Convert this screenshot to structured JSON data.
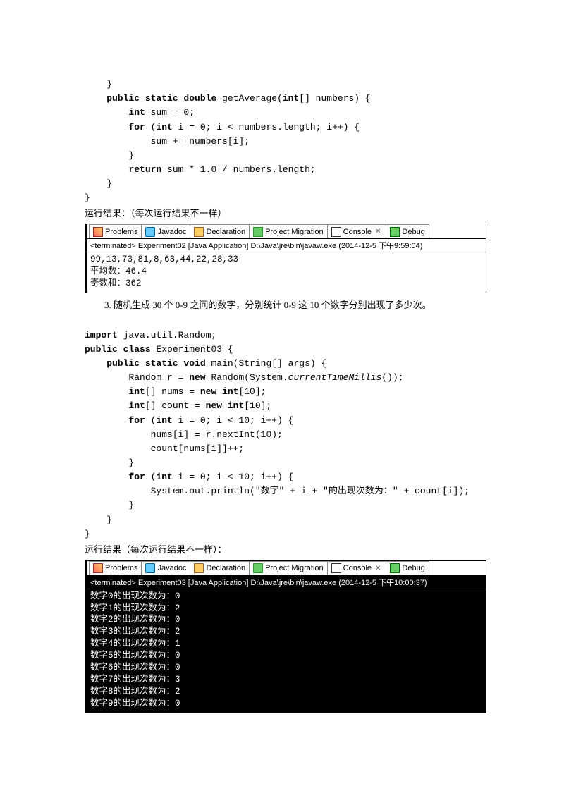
{
  "code1": {
    "l1": "    }",
    "l2a": "    ",
    "l2b": "public static double",
    "l2c": " getAverage(",
    "l2d": "int",
    "l2e": "[] numbers) {",
    "l3a": "        ",
    "l3b": "int",
    "l3c": " sum = 0;",
    "l4a": "        ",
    "l4b": "for",
    "l4c": " (",
    "l4d": "int",
    "l4e": " i = 0; i < numbers.length; i++) {",
    "l5": "            sum += numbers[i];",
    "l6": "        }",
    "l7a": "        ",
    "l7b": "return",
    "l7c": " sum * 1.0 / numbers.length;",
    "l8": "    }",
    "l9": "}"
  },
  "text1": "运行结果：（每次运行结果不一样）",
  "tabs": {
    "problems": "Problems",
    "javadoc": "Javadoc",
    "declaration": "Declaration",
    "project": "Project Migration",
    "console": "Console",
    "debug": "Debug",
    "close": "✕"
  },
  "console1": {
    "term": "<terminated> Experiment02 [Java Application] D:\\Java\\jre\\bin\\javaw.exe (2014-12-5 下午9:59:04)",
    "out": "99,13,73,81,8,63,44,22,28,33\n平均数：46.4\n奇数和：362"
  },
  "text2": "3. 随机生成 30 个 0-9 之间的数字，分别统计 0-9 这 10 个数字分别出现了多少次。",
  "code2": {
    "l1a": "import",
    "l1b": " java.util.Random;",
    "l2a": "public class",
    "l2b": " Experiment03 {",
    "l3a": "    ",
    "l3b": "public static void",
    "l3c": " main(String[] args) {",
    "l4a": "        Random r = ",
    "l4b": "new",
    "l4c": " Random(System.",
    "l4d": "currentTimeMillis",
    "l4e": "());",
    "l5a": "        ",
    "l5b": "int",
    "l5c": "[] nums = ",
    "l5d": "new int",
    "l5e": "[10];",
    "l6a": "        ",
    "l6b": "int",
    "l6c": "[] count = ",
    "l6d": "new int",
    "l6e": "[10];",
    "l7a": "        ",
    "l7b": "for",
    "l7c": " (",
    "l7d": "int",
    "l7e": " i = 0; i < 10; i++) {",
    "l8": "            nums[i] = r.nextInt(10);",
    "l9": "            count[nums[i]]++;",
    "l10": "        }",
    "l11a": "        ",
    "l11b": "for",
    "l11c": " (",
    "l11d": "int",
    "l11e": " i = 0; i < 10; i++) {",
    "l12": "            System.out.println(\"数字\" + i + \"的出现次数为：\" + count[i]);",
    "l13": "        }",
    "l14": "    }",
    "l15": "}"
  },
  "text3": "运行结果（每次运行结果不一样）：",
  "console2": {
    "term": "<terminated> Experiment03 [Java Application] D:\\Java\\jre\\bin\\javaw.exe (2014-12-5 下午10:00:37)",
    "out": "数字0的出现次数为：0\n数字1的出现次数为：2\n数字2的出现次数为：0\n数字3的出现次数为：2\n数字4的出现次数为：1\n数字5的出现次数为：0\n数字6的出现次数为：0\n数字7的出现次数为：3\n数字8的出现次数为：2\n数字9的出现次数为：0"
  }
}
